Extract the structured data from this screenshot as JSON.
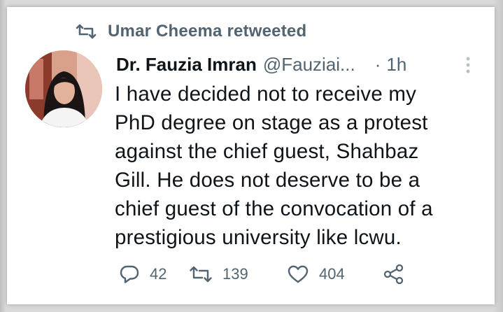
{
  "retweet_banner": {
    "icon": "retweet-icon",
    "text": "Umar Cheema retweeted"
  },
  "tweet": {
    "author_name": "Dr. Fauzia Imran",
    "author_handle": "@Fauziai...",
    "separator": "·",
    "timestamp": "1h",
    "avatar": "avatar-image",
    "text": "I have decided not to receive my\nPhD degree on stage as a protest\nagainst the chief guest, Shahbaz\nGill. He does not deserve to be a\nchief guest of the convocation of a\nprestigious university like lcwu.",
    "actions": {
      "reply": {
        "icon": "reply-icon",
        "count": "42"
      },
      "retweet": {
        "icon": "retweet-icon",
        "count": "139"
      },
      "like": {
        "icon": "heart-icon",
        "count": "404"
      },
      "share": {
        "icon": "share-icon"
      }
    }
  },
  "colors": {
    "text_primary": "#0f1419",
    "text_secondary": "#536471",
    "card_background": "#ffffff"
  }
}
